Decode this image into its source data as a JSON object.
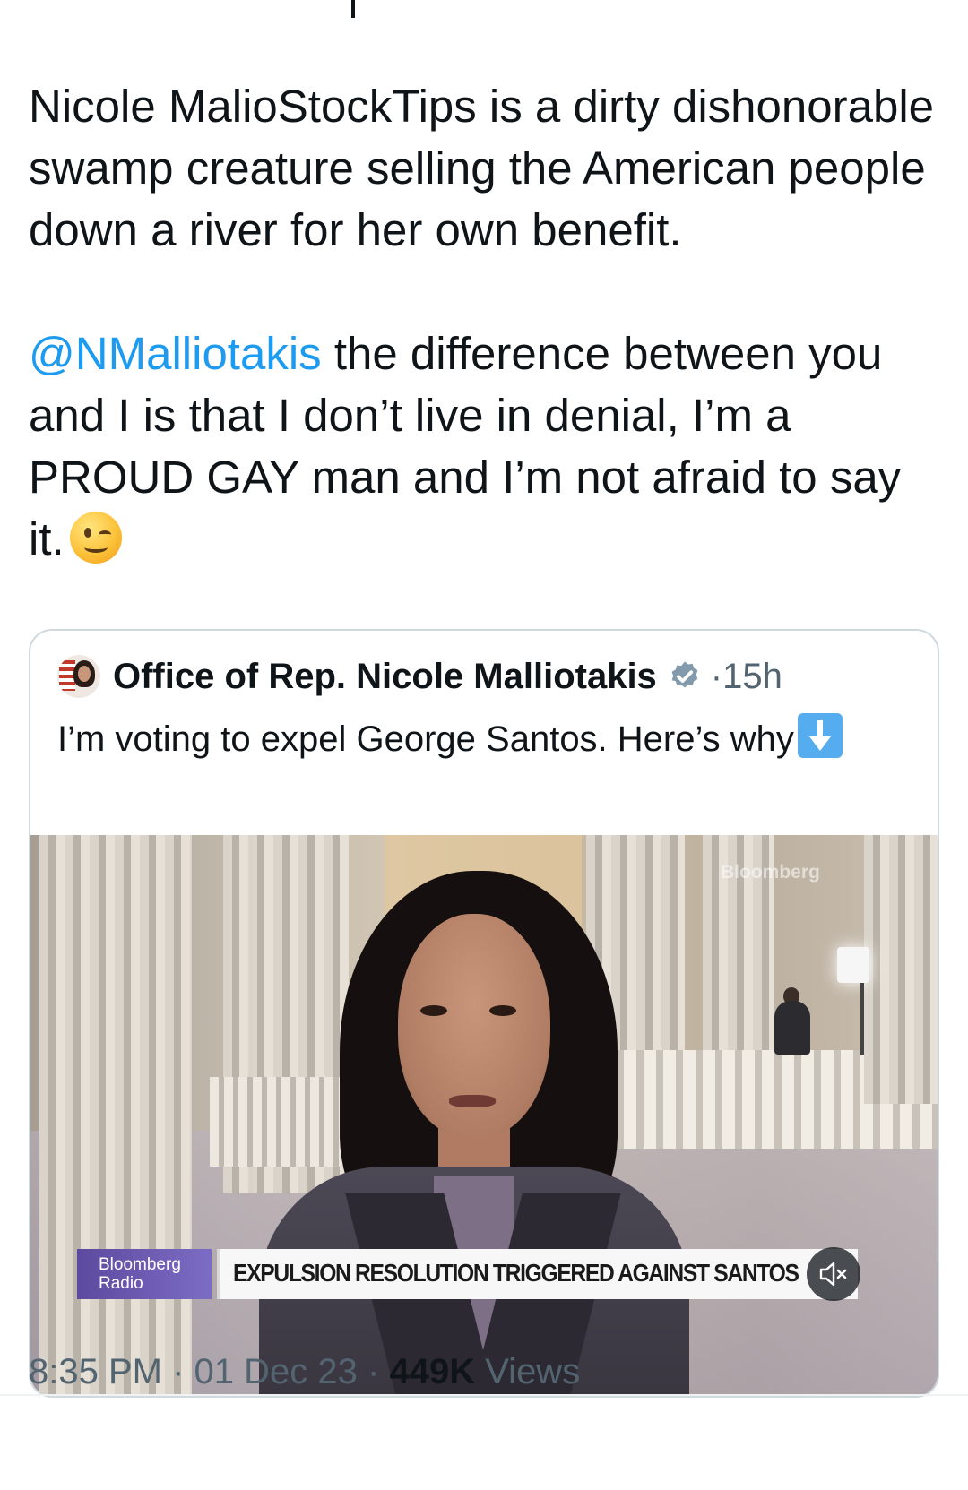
{
  "tweet": {
    "paragraph_1": "Nicole MalioStockTips is a dirty dishonorable swamp creature selling the American people down a river for her own benefit.",
    "mention": "@NMalliotakis",
    "paragraph_2_rest": " the difference between you and I is that I don’t live in denial, I’m a PROUD GAY man and I’m not afraid to say it.",
    "emoji": "winking-face"
  },
  "quoted_tweet": {
    "author_name": "Office of Rep. Nicole Malliotakis",
    "verified": true,
    "separator": "·",
    "time": "15h",
    "text": "I’m voting to expel George Santos. Here’s why",
    "emoji": "down-arrow",
    "video": {
      "watermark": "Bloomberg",
      "station_line_1": "Bloomberg",
      "station_line_2": "Radio",
      "chyron": "EXPULSION RESOLUTION TRIGGERED AGAINST SANTOS",
      "muted": true
    }
  },
  "meta": {
    "time": "8:35 PM",
    "separator": "·",
    "date": "01 Dec 23",
    "views_count": "449K",
    "views_label": "Views"
  },
  "colors": {
    "text": "#0f1419",
    "secondary": "#536471",
    "link": "#1d9bf0",
    "border": "#cfd9de",
    "verified_badge": "#829aab",
    "station_purple": "#6a5ab0"
  }
}
